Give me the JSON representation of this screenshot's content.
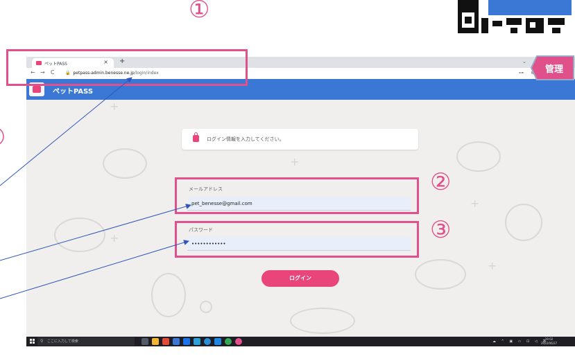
{
  "browser": {
    "tab_title": "ペットPASS",
    "tab_close": "×",
    "new_tab": "+",
    "tabbar_chevron": "⌄",
    "back": "←",
    "forward": "→",
    "reload": "C",
    "url_domain": "petpass-admin.benesse.ne.jp",
    "url_path": "/login/index",
    "url_icons": "⊶ ⊕ ⇪"
  },
  "app": {
    "name": "ペットPASS",
    "notice_text": "ログイン情報を入力してください。",
    "email_label": "メールアドレス",
    "email_value": "pet_benesse@gmail.com",
    "password_label": "パスワード",
    "password_value": "••••••••••••",
    "login_label": "ログイン"
  },
  "taskbar": {
    "search_placeholder": "ここに入力して検索",
    "tray": "☁ ^ ▣ ▭ ⊡ ◁ あ",
    "time": "19:02",
    "date": "2022/06/27"
  },
  "annotations": {
    "step1": "①",
    "step2": "②",
    "step3": "③",
    "admin_tag": "管理"
  },
  "colors": {
    "accent_pink": "#e0508a",
    "header_blue": "#3b78d6",
    "button_pink": "#e9457a",
    "arrow_blue": "#2f56b8"
  }
}
